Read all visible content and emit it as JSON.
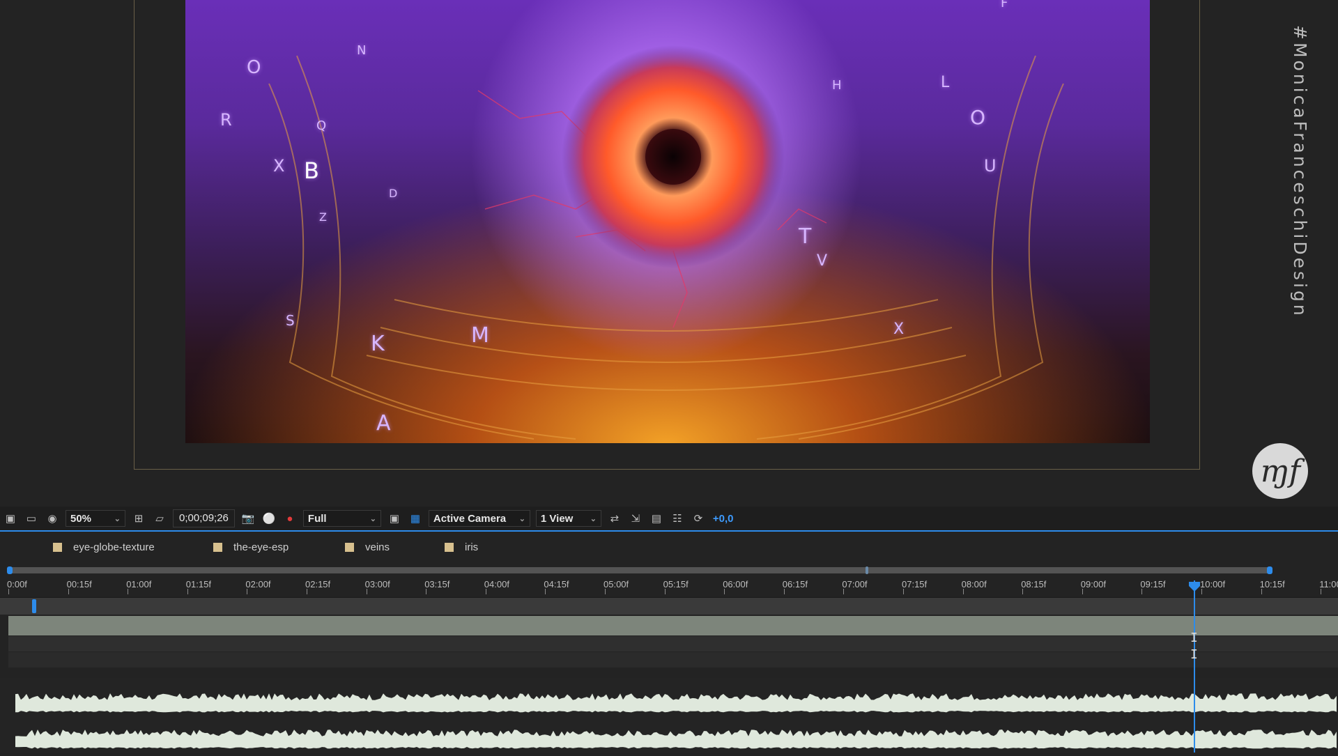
{
  "viewer": {
    "watermark_text": "#MonicaFranceschiDesign",
    "logo_text": "ɱf",
    "floating_letters": [
      "O",
      "R",
      "Q",
      "X",
      "B",
      "D",
      "Z",
      "S",
      "K",
      "M",
      "A",
      "N",
      "O",
      "U",
      "T",
      "V",
      "X",
      "H",
      "L",
      "F"
    ]
  },
  "toolbar": {
    "zoom": "50%",
    "timecode": "0;00;09;26",
    "resolution": "Full",
    "camera": "Active Camera",
    "view_layout": "1 View",
    "exposure": "+0,0"
  },
  "timeline": {
    "markers": [
      "eye-globe-texture",
      "the-eye-esp",
      "veins",
      "iris"
    ],
    "ruler_labels": [
      "0:00f",
      "00:15f",
      "01:00f",
      "01:15f",
      "02:00f",
      "02:15f",
      "03:00f",
      "03:15f",
      "04:00f",
      "04:15f",
      "05:00f",
      "05:15f",
      "06:00f",
      "06:15f",
      "07:00f",
      "07:15f",
      "08:00f",
      "08:15f",
      "09:00f",
      "09:15f",
      "10:00f",
      "10:15f",
      "11:00"
    ],
    "playhead_time": "0;00;09;26"
  },
  "colors": {
    "accent_blue": "#2d8ceb",
    "marker_swatch": "#d7c08e",
    "panel_bg": "#232323"
  }
}
